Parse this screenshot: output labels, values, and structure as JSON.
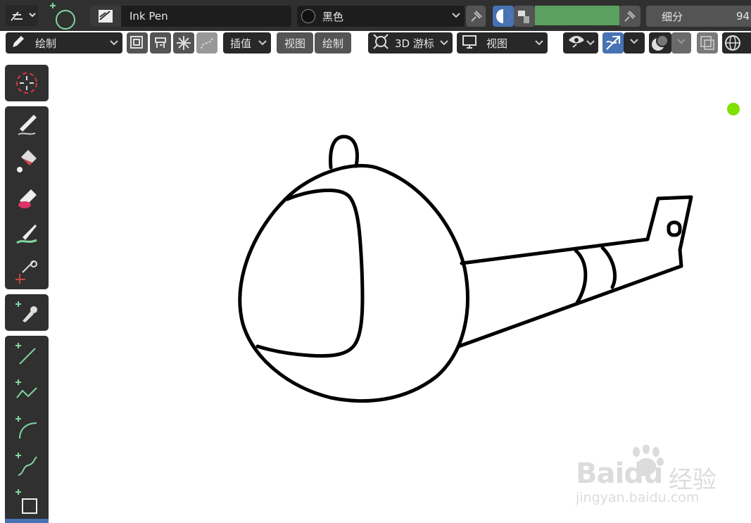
{
  "header": {
    "brush_name": "Ink Pen",
    "material_name": "黑色",
    "subdivide_label": "细分",
    "subdivide_value": "94"
  },
  "toolbar": {
    "mode_label": "绘制",
    "interp_label": "插值",
    "view_tab": "视图",
    "draw_tab": "绘制",
    "cursor_label": "3D 游标",
    "view_label": "视图"
  },
  "colors": {
    "swatch": "#5aa05e",
    "indicator_dot": "#80e000"
  },
  "tools": [
    "cursor-icon",
    "draw-icon",
    "fill-icon",
    "erase-icon",
    "tint-icon",
    "cutter-icon",
    "eyedropper-icon",
    "line-icon",
    "polyline-icon",
    "arc-icon",
    "curve-icon",
    "box-icon"
  ],
  "watermark": {
    "brand": "Baidu",
    "brand_cn": "经验",
    "url": "jingyan.baidu.com"
  }
}
